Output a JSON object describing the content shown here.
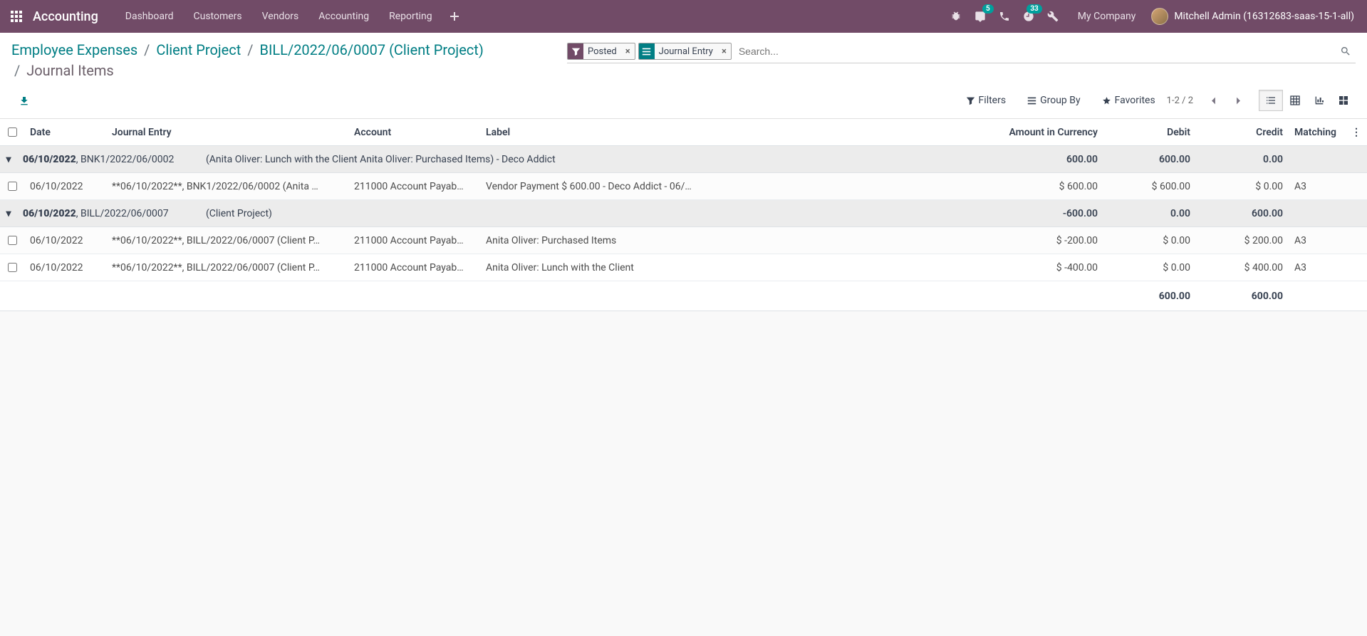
{
  "navbar": {
    "app_name": "Accounting",
    "links": [
      "Dashboard",
      "Customers",
      "Vendors",
      "Accounting",
      "Reporting"
    ],
    "chat_badge": "5",
    "activity_badge": "33",
    "company": "My Company",
    "user": "Mitchell Admin (16312683-saas-15-1-all)"
  },
  "breadcrumb": {
    "parts": [
      "Employee Expenses",
      "Client Project",
      "BILL/2022/06/0007 (Client Project)"
    ],
    "sep": "/",
    "current": "Journal Items"
  },
  "search": {
    "facet1_label": "Posted",
    "facet2_label": "Journal Entry",
    "placeholder": "Search..."
  },
  "controls": {
    "filters": "Filters",
    "groupby": "Group By",
    "favorites": "Favorites",
    "pager": "1-2 / 2"
  },
  "columns": {
    "date": "Date",
    "journal_entry": "Journal Entry",
    "account": "Account",
    "label": "Label",
    "amount": "Amount in Currency",
    "debit": "Debit",
    "credit": "Credit",
    "matching": "Matching"
  },
  "groups": [
    {
      "date": "06/10/2022",
      "ref": ", BNK1/2022/06/0002",
      "title": "(Anita Oliver: Lunch with the Client Anita Oliver: Purchased Items) - Deco Addict",
      "amount": "600.00",
      "debit": "600.00",
      "credit": "0.00",
      "rows": [
        {
          "date": "06/10/2022",
          "je": "**06/10/2022**, BNK1/2022/06/0002 (Anita …",
          "account": "211000 Account Payab…",
          "label": "Vendor Payment $ 600.00 - Deco Addict - 06/…",
          "amount": "$ 600.00",
          "debit": "$ 600.00",
          "credit": "$ 0.00",
          "match": "A3"
        }
      ]
    },
    {
      "date": "06/10/2022",
      "ref": ", BILL/2022/06/0007",
      "title": "(Client Project)",
      "amount": "-600.00",
      "debit": "0.00",
      "credit": "600.00",
      "rows": [
        {
          "date": "06/10/2022",
          "je": "**06/10/2022**, BILL/2022/06/0007 (Client P…",
          "account": "211000 Account Payab…",
          "label": "Anita Oliver: Purchased Items",
          "amount": "$ -200.00",
          "debit": "$ 0.00",
          "credit": "$ 200.00",
          "match": "A3"
        },
        {
          "date": "06/10/2022",
          "je": "**06/10/2022**, BILL/2022/06/0007 (Client P…",
          "account": "211000 Account Payab…",
          "label": "Anita Oliver: Lunch with the Client",
          "amount": "$ -400.00",
          "debit": "$ 0.00",
          "credit": "$ 400.00",
          "match": "A3"
        }
      ]
    }
  ],
  "totals": {
    "debit": "600.00",
    "credit": "600.00"
  }
}
